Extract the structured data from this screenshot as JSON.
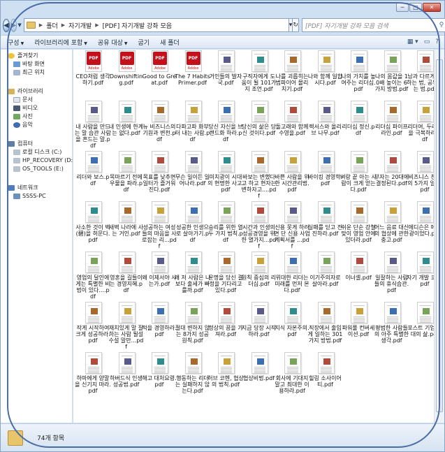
{
  "window": {
    "caption": {
      "minimize": "─",
      "maximize": "□",
      "close": "✕"
    }
  },
  "address": {
    "crumbs": [
      "폴더",
      "자기개발",
      "[PDF] 자기개발 강좌 모음"
    ],
    "search_placeholder": "[PDF] 자기개발 강좌 모음 검색"
  },
  "toolbar": {
    "items": [
      "구성",
      "라이브러리에 포함",
      "공유 대상",
      "굽기",
      "새 폴더"
    ]
  },
  "sidebar": {
    "favorites": {
      "label": "즐겨찾기",
      "items": [
        "바탕 화면",
        "최근 위치"
      ]
    },
    "libraries": {
      "label": "라이브러리",
      "items": [
        "문서",
        "비디오",
        "사진",
        "음악"
      ]
    },
    "computer": {
      "label": "컴퓨터",
      "items": [
        "로컬 디스크 (C:)",
        "HP_RECOVERY (D:)",
        "OS_TOOLS (E:)"
      ]
    },
    "network": {
      "label": "네트워크",
      "items": [
        "SSSS-PC"
      ]
    }
  },
  "files": [
    "CEO처럼 생각하기.pdf",
    "Downshifting.pdf",
    "Good to Great.pdf",
    "The 7 Habits Primer.pdf",
    "거인들의 발자국.pdf",
    "구직자에게 도움이 될 101가지 조언.pdf",
    "나를 괴롭히는 범파이어 몰리치기.pdf",
    "나와 함께 일합시다.pdf",
    "나의 가치를 높여주는 리더십.pdf",
    "나의 몸값을 10배 높이는 6가지 방법.pdf",
    "남과 다르게 일하는 법, 공부하는 법.pdf",
    "내 사람을 만드는 말 습관 사람을 흔드는 말.pdf",
    "내 인생에 한계는 없다.pdf",
    "뉴 비즈니스의 기원과 변천.pdf",
    "다파고파 화부터 내는 사람.pdf",
    "당신 자신을 브랜드화 하라.pdf",
    "당신의 삶은 당신 것이다.pdf",
    "돌고래와 함께 수영을.pdf",
    "렉서스와 올리브 나무.pdf",
    "리더십 정신.pdf",
    "리더십 파이프라인.pdf",
    "리더여, 두려움을 극복하라.pdf",
    "리더와 보스.pdf",
    "목마르기 전에 우물을 파라.pdf",
    "목표를 낮추면 일터가 즐거워진다.pdf",
    "무슨 일이든 일어나라.pdf",
    "미치광이 시대의 현명한 사고.pdf",
    "바보는 변했다고 하고 현자는 변하자고....pdf",
    "바쁜 사람을 위한 시간관리법.pdf",
    "바이킹 경영학.pdf",
    "벼랑 끝 아는 사람이 크게 얻는다.pdf",
    "부자는 20대에 결정된다.pdf",
    "비즈니스 천재의 5가지 얼굴.pdf",
    "사소한 것이 벽(碧)을 허문다.pdf",
    "새벽 나라에 사는 거인.pdf",
    "성공하는 여성들의 마음을 사로잡는 리...pdf",
    "성공한 인생으로 살아가기.pdf",
    "승리를 위한 열두 가지 법칙.pdf",
    "시간과 인생의 성공경영을 위한 열가지...pdf",
    "신용 못게 하려면 단 신용 사업계획서를 ...pdf",
    "실패를 딛고 전진하라.pdf",
    "쉬운 단순 강철맞이 영업 안에 있더라.pdf",
    "어느 음료 대신의 협상에 관한 충고.pdf",
    "에디슨은 메모광이었다.pdf",
    "영업의 달인에게는 특별한 비법이 있다....pdf",
    "영혼을 길들이는 경영지혜.pdf",
    "왜 이제서야 사는가.pdf",
    "왜 저 사람은 나보다 출세가 빠를까.pdf",
    "운명을 당신 결정을 기다리고 있다.pdf",
    "원칙 중심의 리더십.pdf",
    "위대한 리더는 미래를 먼저 본다.pdf",
    "이기주의자로 살아라.pdf",
    "이너셀.pdf",
    "일잘하는 사람들의 휴식습관.pdf",
    "자기 개발 코치.pdf",
    "작게 시작하여 크게 성공하라.pdf",
    "재치있게 말 잘하는 사람 될설 수설 말만...pdf",
    "적을 경영하라.pdf",
    "절대 변하지 않는 8가지 성공 원칙.pdf",
    "정상의 꿈을 가져라.pdf",
    "지금 당장 시작하라.pdf",
    "지식 자본주의.pdf",
    "직장에서 출입게 일하는 301가지 방법.pdf",
    "파워풀 컨버세이션.pdf",
    "평범한 사람들의 아주 특별한 생각.pdf",
    "포스트 기업 시대의 삶.pdf",
    "하마에게 양말을 신기지 마라.pdf",
    "하버드식 인생성공법.pdf",
    "해고 대처요령.pdf",
    "행동하는 리더는 실패하지 않는다.pdf",
    "허브 코헨, 협상의 법칙.pdf",
    "협상비법.pdf",
    "회사에 기대지 말고 최대한 이용하라.pdf",
    "힐링 소사이어티.pdf"
  ],
  "status": {
    "count": "74개 항목"
  }
}
